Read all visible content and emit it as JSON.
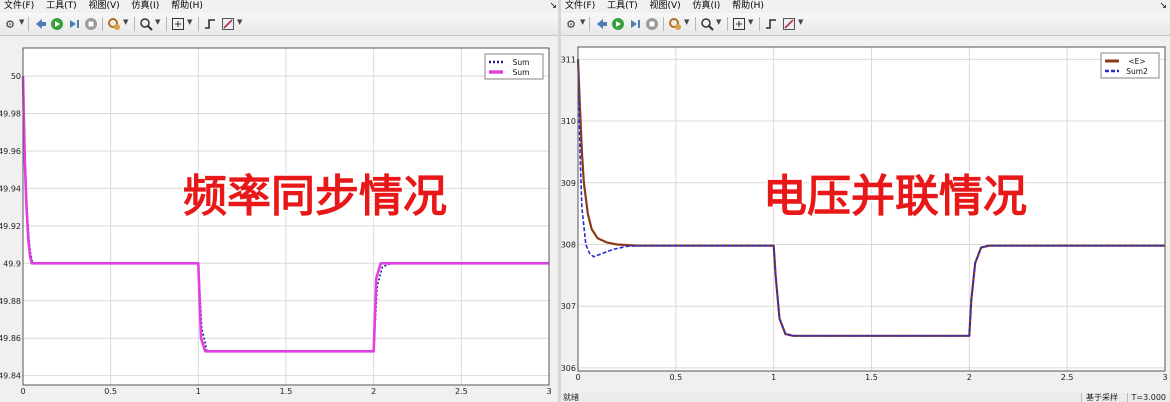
{
  "menu": {
    "items": [
      "文件(F)",
      "工具(T)",
      "视图(V)",
      "仿真(I)",
      "帮助(H)"
    ],
    "pin_glyph": "↘"
  },
  "toolbar": {
    "icons": [
      "gear-icon",
      "back-icon",
      "run-icon",
      "step-icon",
      "stop-icon",
      "highlight-icon",
      "zoom-icon",
      "fit-icon",
      "trigger-icon",
      "style-icon"
    ]
  },
  "colors": {
    "left_series_1": "#1a1a8c",
    "left_series_2": "#e040e0",
    "right_series_1": "#8b3a1a",
    "right_series_2": "#2b2bd0",
    "overlay_text": "#e81818",
    "plot_bg": "#ffffff",
    "grid": "#d9d9d9"
  },
  "left": {
    "overlay_title": "频率同步情况",
    "legend": [
      "Sum",
      "Sum"
    ]
  },
  "right": {
    "overlay_title": "电压并联情况",
    "legend": [
      "<E>",
      "Sum2"
    ],
    "status": {
      "left": "就绪",
      "box1": "基于采样",
      "box2": "T=3.000"
    }
  },
  "chart_data": [
    {
      "type": "line",
      "title": "",
      "xlabel": "",
      "ylabel": "",
      "xlim": [
        0,
        3
      ],
      "ylim": [
        49.835,
        50.015
      ],
      "x_ticks": [
        "0",
        "0.5",
        "1",
        "1.5",
        "2",
        "2.5",
        "3"
      ],
      "y_ticks": [
        "49.84",
        "49.86",
        "49.88",
        "49.9",
        "49.92",
        "49.94",
        "49.96",
        "49.98",
        "50"
      ],
      "grid": true,
      "legend_position": "top-right",
      "series": [
        {
          "name": "Sum",
          "style": "dotted",
          "points": [
            [
              0,
              50.0
            ],
            [
              0.01,
              49.96
            ],
            [
              0.02,
              49.935
            ],
            [
              0.03,
              49.918
            ],
            [
              0.04,
              49.907
            ],
            [
              0.055,
              49.9
            ],
            [
              0.08,
              49.9
            ],
            [
              0.5,
              49.9
            ],
            [
              0.99,
              49.9
            ],
            [
              1.0,
              49.9
            ],
            [
              1.02,
              49.865
            ],
            [
              1.05,
              49.853
            ],
            [
              1.1,
              49.853
            ],
            [
              1.5,
              49.853
            ],
            [
              1.99,
              49.853
            ],
            [
              2.0,
              49.853
            ],
            [
              2.02,
              49.888
            ],
            [
              2.05,
              49.898
            ],
            [
              2.1,
              49.9
            ],
            [
              2.5,
              49.9
            ],
            [
              3.0,
              49.9
            ]
          ]
        },
        {
          "name": "Sum",
          "style": "solid",
          "points": [
            [
              0,
              50.0
            ],
            [
              0.01,
              49.955
            ],
            [
              0.02,
              49.93
            ],
            [
              0.03,
              49.913
            ],
            [
              0.04,
              49.904
            ],
            [
              0.05,
              49.9
            ],
            [
              0.5,
              49.9
            ],
            [
              0.99,
              49.9
            ],
            [
              1.0,
              49.9
            ],
            [
              1.015,
              49.86
            ],
            [
              1.04,
              49.853
            ],
            [
              1.5,
              49.853
            ],
            [
              1.99,
              49.853
            ],
            [
              2.0,
              49.853
            ],
            [
              2.015,
              49.892
            ],
            [
              2.04,
              49.9
            ],
            [
              2.5,
              49.9
            ],
            [
              3.0,
              49.9
            ]
          ]
        }
      ]
    },
    {
      "type": "line",
      "title": "",
      "xlabel": "",
      "ylabel": "",
      "xlim": [
        0,
        3
      ],
      "ylim": [
        305.95,
        311.2
      ],
      "x_ticks": [
        "0",
        "0.5",
        "1",
        "1.5",
        "2",
        "2.5",
        "3"
      ],
      "y_ticks": [
        "306",
        "307",
        "308",
        "309",
        "310",
        "311"
      ],
      "grid": true,
      "legend_position": "top-right",
      "series": [
        {
          "name": "<E>",
          "style": "solid",
          "points": [
            [
              0,
              311.0
            ],
            [
              0.01,
              310.2
            ],
            [
              0.02,
              309.5
            ],
            [
              0.03,
              309.0
            ],
            [
              0.05,
              308.5
            ],
            [
              0.07,
              308.25
            ],
            [
              0.1,
              308.1
            ],
            [
              0.15,
              308.03
            ],
            [
              0.2,
              308.0
            ],
            [
              0.3,
              307.98
            ],
            [
              0.5,
              307.98
            ],
            [
              1.0,
              307.98
            ],
            [
              1.01,
              307.5
            ],
            [
              1.03,
              306.8
            ],
            [
              1.06,
              306.55
            ],
            [
              1.1,
              306.52
            ],
            [
              1.5,
              306.52
            ],
            [
              2.0,
              306.52
            ],
            [
              2.01,
              307.1
            ],
            [
              2.03,
              307.7
            ],
            [
              2.06,
              307.95
            ],
            [
              2.1,
              307.98
            ],
            [
              2.5,
              307.98
            ],
            [
              3.0,
              307.98
            ]
          ]
        },
        {
          "name": "Sum2",
          "style": "dashed",
          "points": [
            [
              0,
              311.0
            ],
            [
              0.01,
              309.5
            ],
            [
              0.02,
              308.6
            ],
            [
              0.04,
              308.0
            ],
            [
              0.06,
              307.85
            ],
            [
              0.08,
              307.8
            ],
            [
              0.12,
              307.85
            ],
            [
              0.18,
              307.92
            ],
            [
              0.25,
              307.97
            ],
            [
              0.3,
              307.98
            ],
            [
              0.5,
              307.98
            ],
            [
              1.0,
              307.98
            ],
            [
              1.01,
              307.5
            ],
            [
              1.03,
              306.8
            ],
            [
              1.06,
              306.55
            ],
            [
              1.1,
              306.52
            ],
            [
              1.5,
              306.52
            ],
            [
              2.0,
              306.52
            ],
            [
              2.01,
              307.1
            ],
            [
              2.03,
              307.7
            ],
            [
              2.06,
              307.95
            ],
            [
              2.1,
              307.98
            ],
            [
              2.5,
              307.98
            ],
            [
              3.0,
              307.98
            ]
          ]
        }
      ]
    }
  ]
}
